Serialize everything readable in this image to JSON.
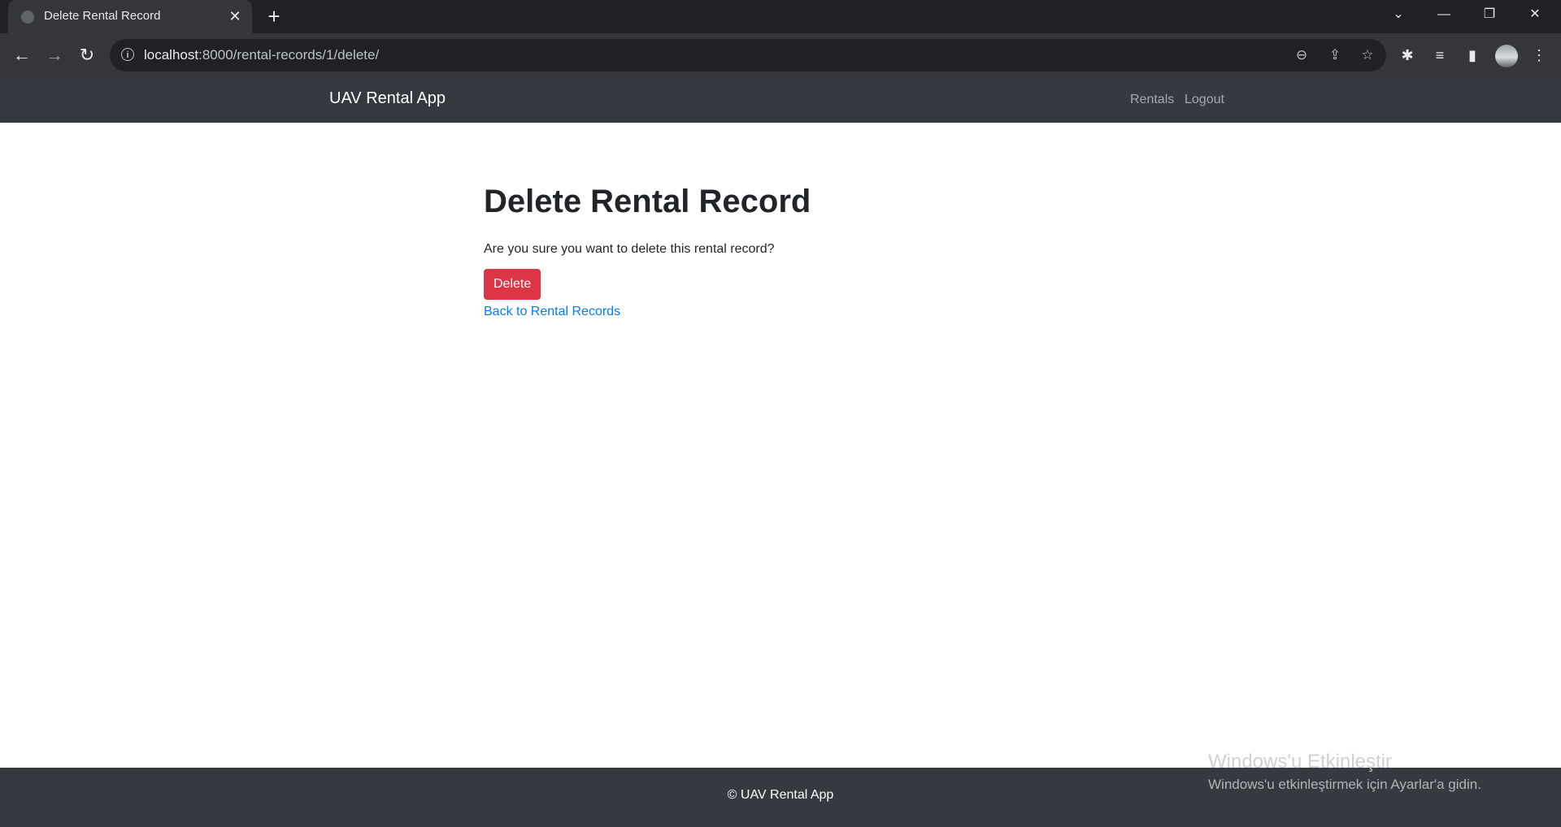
{
  "browser": {
    "tab_title": "Delete Rental Record",
    "url_host": "localhost",
    "url_path": ":8000/rental-records/1/delete/"
  },
  "navbar": {
    "brand": "UAV Rental App",
    "links": [
      "Rentals",
      "Logout"
    ]
  },
  "main": {
    "title": "Delete Rental Record",
    "confirm_text": "Are you sure you want to delete this rental record?",
    "delete_label": "Delete",
    "back_link": "Back to Rental Records"
  },
  "footer": {
    "text": "© UAV Rental App"
  },
  "watermark": {
    "title": "Windows'u Etkinleştir",
    "subtitle": "Windows'u etkinleştirmek için Ayarlar'a gidin."
  },
  "colors": {
    "navbar_bg": "#343a40",
    "danger": "#dc3545",
    "link": "#007bff"
  }
}
